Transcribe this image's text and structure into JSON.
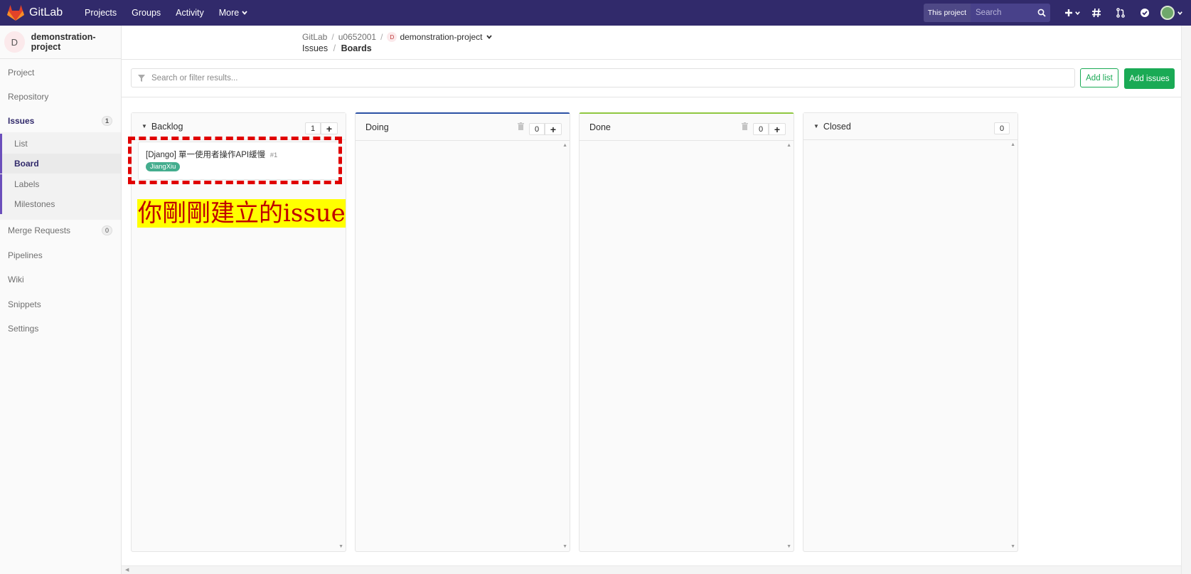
{
  "navbar": {
    "brand": "GitLab",
    "links": [
      "Projects",
      "Groups",
      "Activity",
      "More"
    ],
    "scope": "This project",
    "search_placeholder": "Search"
  },
  "sidebar": {
    "project_initial": "D",
    "project_name": "demonstration-project",
    "items": [
      {
        "label": "Project"
      },
      {
        "label": "Repository"
      },
      {
        "label": "Issues",
        "badge": "1"
      },
      {
        "label": "Merge Requests",
        "badge": "0"
      },
      {
        "label": "Pipelines"
      },
      {
        "label": "Wiki"
      },
      {
        "label": "Snippets"
      },
      {
        "label": "Settings"
      }
    ],
    "issues_sub": [
      "List",
      "Board",
      "Labels",
      "Milestones"
    ]
  },
  "breadcrumb": {
    "root": "GitLab",
    "user": "u0652001",
    "project_initial": "D",
    "project": "demonstration-project",
    "section": "Issues",
    "page": "Boards"
  },
  "filter": {
    "placeholder": "Search or filter results..."
  },
  "buttons": {
    "add_list": "Add list",
    "add_issues": "Add issues"
  },
  "boards": [
    {
      "title": "Backlog",
      "count": "1",
      "accent": "#fafafa"
    },
    {
      "title": "Doing",
      "count": "0",
      "accent": "#2b51a4"
    },
    {
      "title": "Done",
      "count": "0",
      "accent": "#8fc740"
    },
    {
      "title": "Closed",
      "count": "0",
      "accent": "#fafafa"
    }
  ],
  "card": {
    "title": "[Django] 單一使用者操作API緩慢",
    "number": "#1",
    "label": "JiangXiu",
    "label_color": "#44ad8e"
  },
  "annotation": {
    "text": "你剛剛建立的issue",
    "highlight_color": "#ffff00",
    "text_color": "#c00000",
    "box_color": "#e00000"
  }
}
